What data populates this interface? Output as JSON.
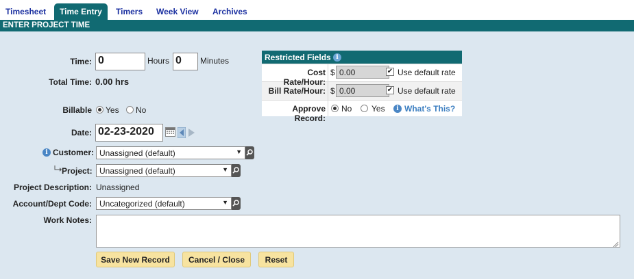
{
  "tabs": [
    {
      "label": "Timesheet"
    },
    {
      "label": "Time Entry"
    },
    {
      "label": "Timers"
    },
    {
      "label": "Week View"
    },
    {
      "label": "Archives"
    }
  ],
  "section_title": "ENTER PROJECT TIME",
  "form": {
    "time_label": "Time:",
    "hours_value": "0",
    "hours_label": "Hours",
    "minutes_value": "0",
    "minutes_label": "Minutes",
    "total_time_label": "Total Time:",
    "total_time_value": "0.00 hrs",
    "billable_label": "Billable",
    "billable_yes": "Yes",
    "billable_no": "No",
    "date_label": "Date:",
    "date_value": "02-23-2020",
    "customer_label": "Customer:",
    "customer_value": "Unassigned (default)",
    "project_label": "Project:",
    "project_value": "Unassigned (default)",
    "project_desc_label": "Project Description:",
    "project_desc_value": "Unassigned",
    "account_label": "Account/Dept Code:",
    "account_value": "Uncategorized (default)",
    "notes_label": "Work Notes:",
    "notes_value": ""
  },
  "restricted": {
    "title": "Restricted Fields",
    "cost_rate_label": "Cost Rate/Hour:",
    "cost_rate_value": "0.00",
    "bill_rate_label": "Bill Rate/Hour:",
    "bill_rate_value": "0.00",
    "currency": "$",
    "use_default_label": "Use default rate",
    "approve_label": "Approve Record:",
    "approve_no": "No",
    "approve_yes": "Yes",
    "whats_this": "What's This?"
  },
  "buttons": {
    "save": "Save New Record",
    "cancel": "Cancel / Close",
    "reset": "Reset"
  },
  "colors": {
    "accent": "#116a72",
    "panel": "#dce7f0",
    "button": "#f7e3a0",
    "link": "#1a2fa0"
  },
  "icons": {
    "info": "info-icon",
    "calendar": "calendar-icon",
    "lookup": "search-icon",
    "arrow_prev": "arrow-left-icon",
    "arrow_next": "arrow-right-icon"
  }
}
